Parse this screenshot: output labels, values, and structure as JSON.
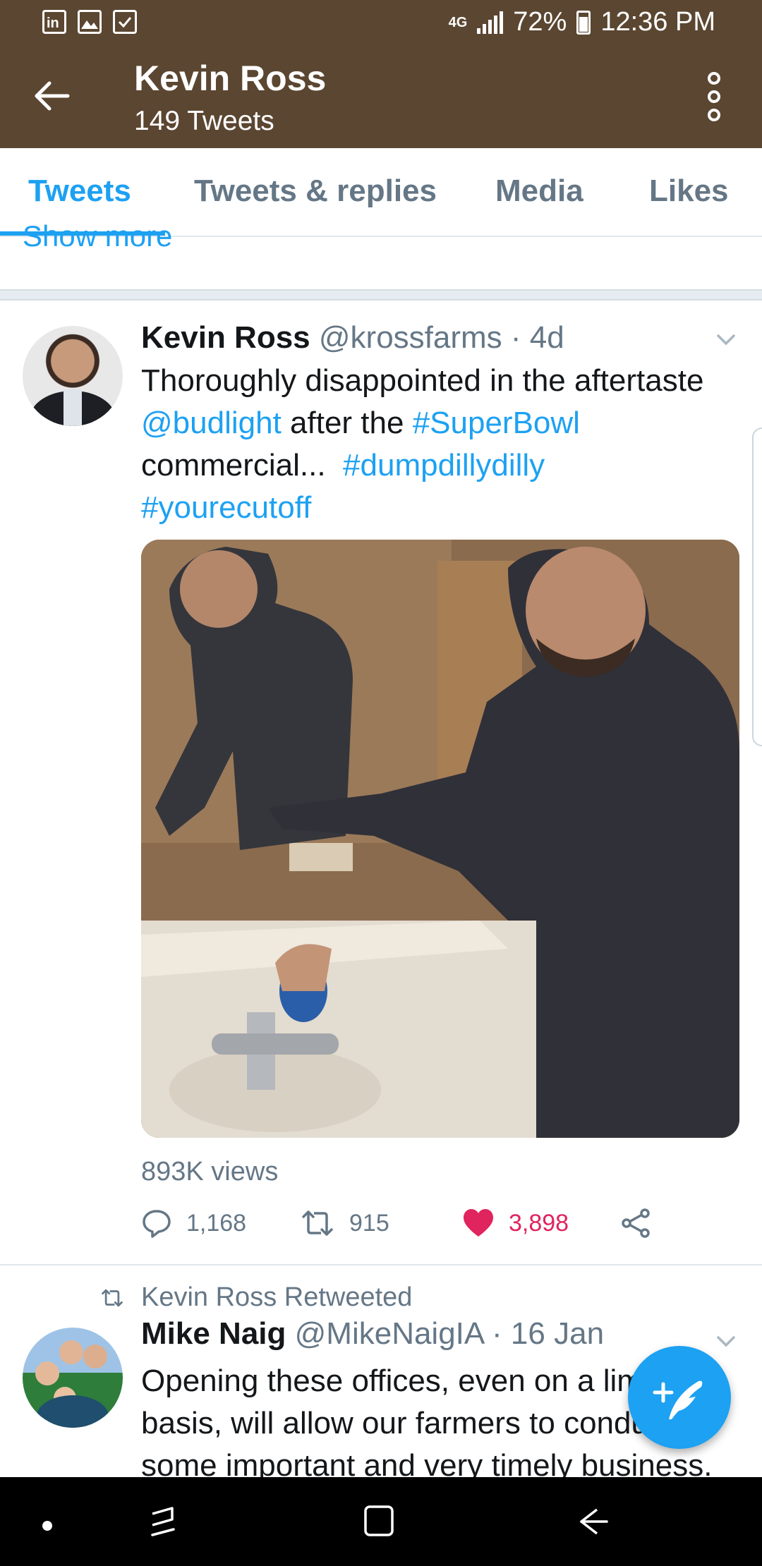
{
  "status_bar": {
    "network": "4G",
    "battery_percent": "72%",
    "time": "12:36 PM",
    "notification_icons": [
      "linkedin-icon",
      "image-icon",
      "task-icon"
    ]
  },
  "header": {
    "title": "Kevin Ross",
    "subtitle": "149 Tweets"
  },
  "tabs": [
    {
      "label": "Tweets",
      "active": true
    },
    {
      "label": "Tweets & replies",
      "active": false
    },
    {
      "label": "Media",
      "active": false
    },
    {
      "label": "Likes",
      "active": false
    }
  ],
  "show_more": "Show more",
  "tweet1": {
    "name": "Kevin Ross",
    "meta": "@krossfarms · 4d",
    "text_1": "Thoroughly disappointed in the aftertaste",
    "mention": "@budlight",
    "text_2": " after the ",
    "hashtag_1": "#SuperBowl",
    "text_3": "commercial...  ",
    "hashtag_2": "#dumpdillydilly",
    "hashtag_3": "#yourecutoff",
    "views": "893K views",
    "replies": "1,168",
    "retweets": "915",
    "likes": "3,898"
  },
  "retweet_label": "Kevin Ross Retweeted",
  "tweet2": {
    "name": "Mike Naig",
    "meta": "@MikeNaigIA · 16 Jan",
    "text": "Opening these offices, even on a limited basis, will allow our farmers to conduct some important and very timely business."
  },
  "colors": {
    "header_bg": "#5b4631",
    "accent": "#1da1f2",
    "like": "#e0245e",
    "muted": "#657786"
  }
}
